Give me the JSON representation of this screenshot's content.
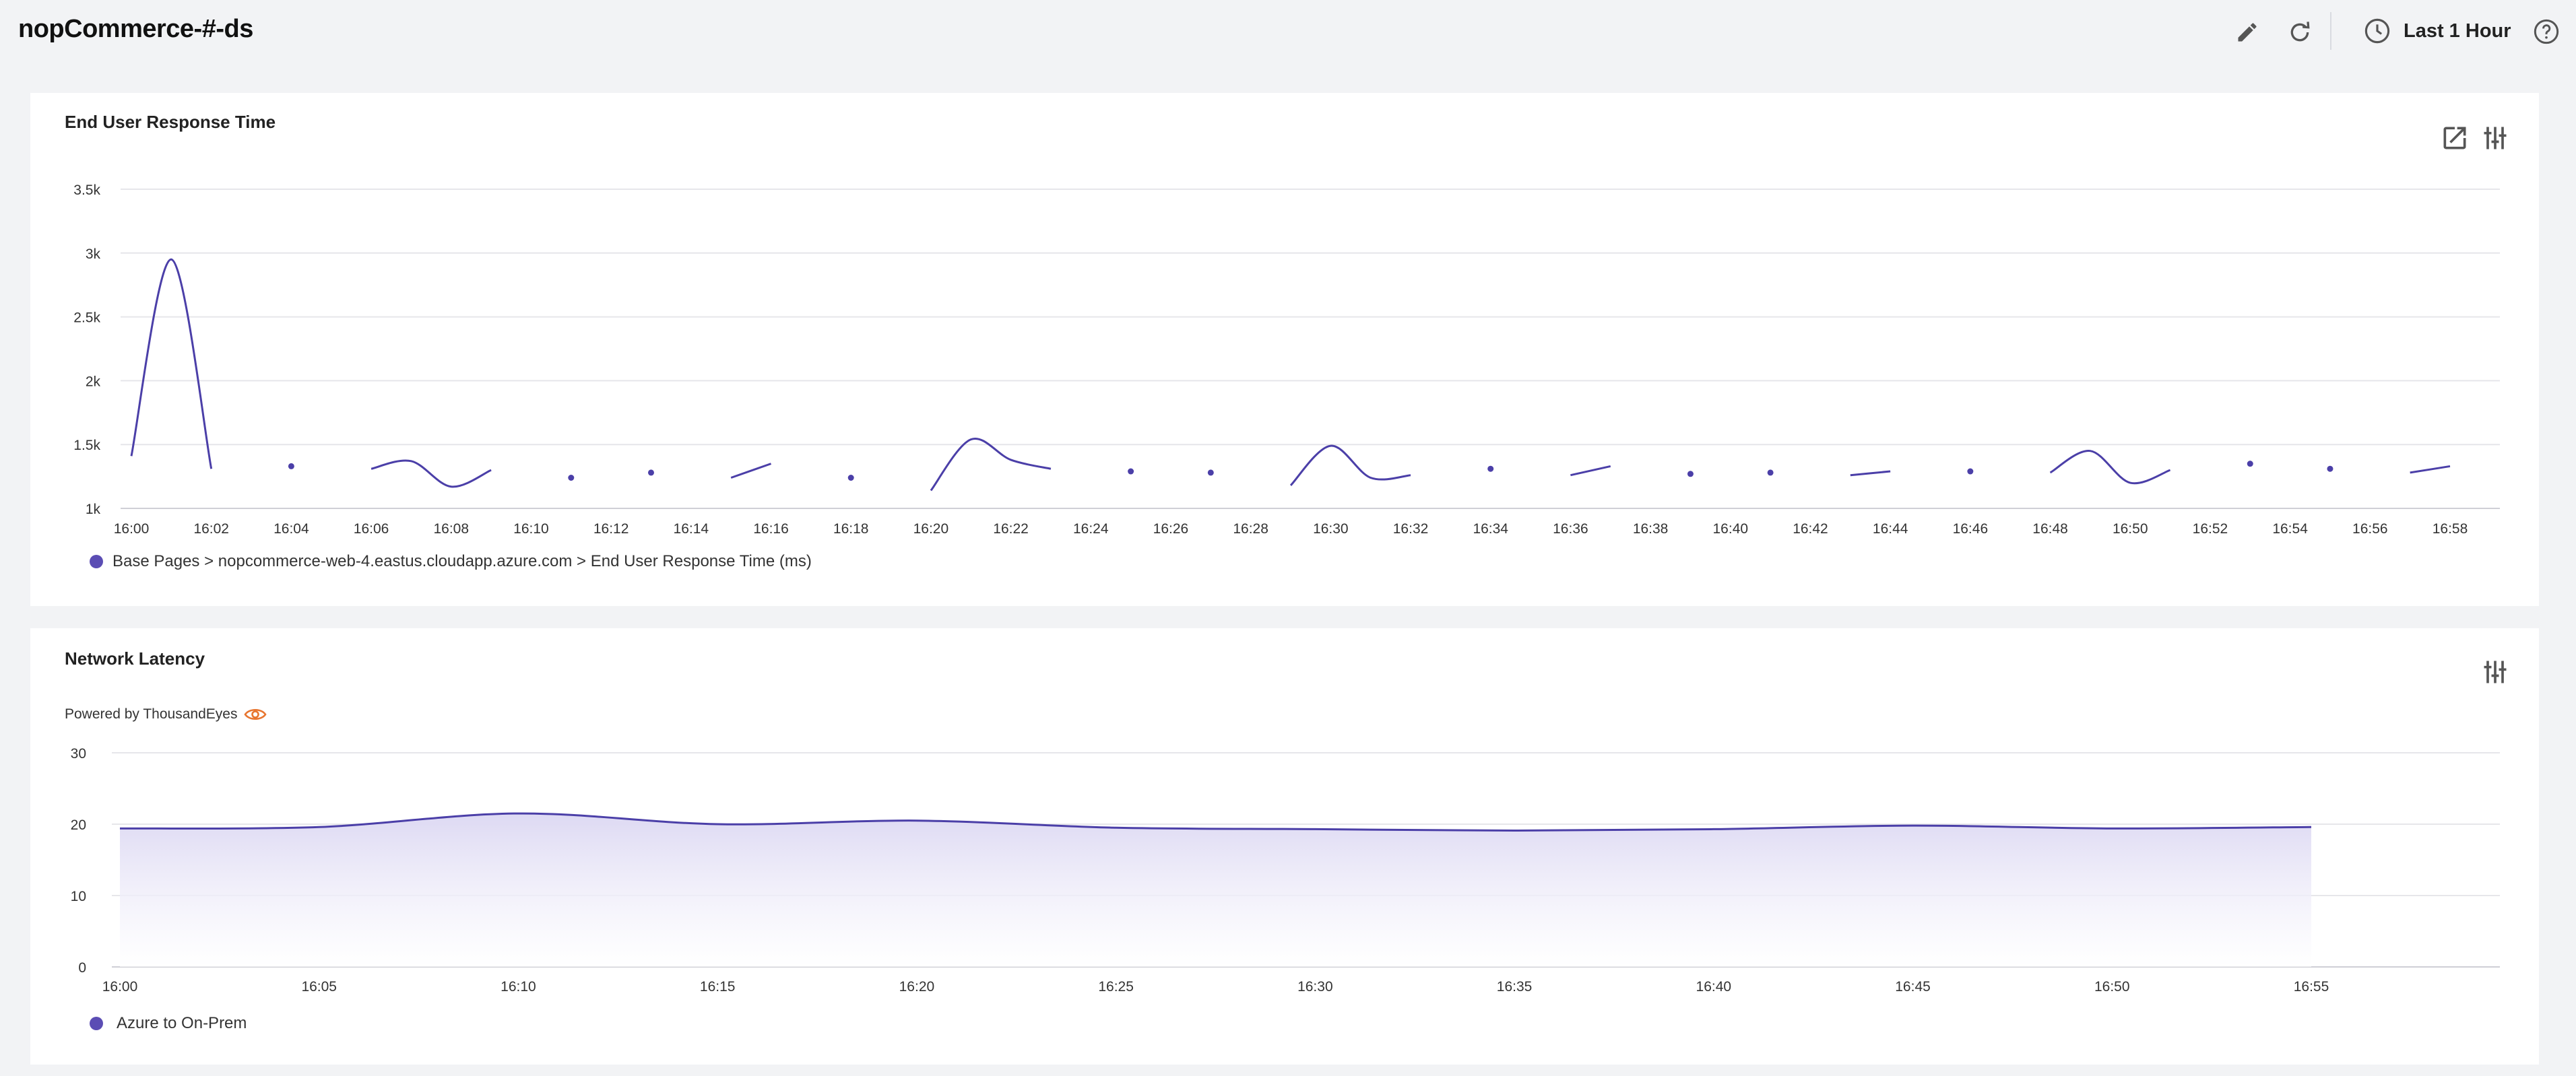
{
  "header": {
    "title": "nopCommerce-#-ds",
    "time_range": "Last 1 Hour",
    "icons": {
      "edit": "pencil-icon",
      "refresh": "refresh-icon",
      "clock": "clock-icon",
      "help": "help-icon"
    }
  },
  "colors": {
    "series": "#4b3fa8",
    "area_fill": "#ddd9f3",
    "grid": "#e6e6ea",
    "background": "#f2f3f5",
    "panel": "#ffffff",
    "eye_icon": "#e8752f"
  },
  "panels": {
    "response": {
      "title": "End User Response Time",
      "legend": "Base Pages > nopcommerce-web-4.eastus.cloudapp.azure.com > End User Response Time (ms)",
      "icons": [
        "external-link-icon",
        "settings-sliders-icon"
      ]
    },
    "latency": {
      "title": "Network Latency",
      "powered_by": "Powered by ThousandEyes",
      "legend": "Azure to On-Prem",
      "icons": [
        "eye-icon",
        "settings-sliders-icon"
      ]
    }
  },
  "chart_data": [
    {
      "type": "line",
      "title": "End User Response Time",
      "ylim": [
        1000,
        3500
      ],
      "y_ticks": [
        "1k",
        "1.5k",
        "2k",
        "2.5k",
        "3k",
        "3.5k"
      ],
      "y_tick_values": [
        1000,
        1500,
        2000,
        2500,
        3000,
        3500
      ],
      "x_range_minutes": [
        0,
        59
      ],
      "x_ticks": [
        "16:00",
        "16:02",
        "16:04",
        "16:06",
        "16:08",
        "16:10",
        "16:12",
        "16:14",
        "16:16",
        "16:18",
        "16:20",
        "16:22",
        "16:24",
        "16:26",
        "16:28",
        "16:30",
        "16:32",
        "16:34",
        "16:36",
        "16:38",
        "16:40",
        "16:42",
        "16:44",
        "16:46",
        "16:48",
        "16:50",
        "16:52",
        "16:54",
        "16:56",
        "16:58"
      ],
      "grid": true,
      "series": [
        {
          "name": "Base Pages > nopcommerce-web-4.eastus.cloudapp.azure.com > End User Response Time (ms)",
          "segments": [
            [
              [
                0,
                1410
              ],
              [
                1,
                2950
              ],
              [
                2,
                1310
              ]
            ],
            [
              [
                4,
                1330
              ]
            ],
            [
              [
                6,
                1310
              ],
              [
                7,
                1370
              ],
              [
                8,
                1170
              ],
              [
                9,
                1300
              ]
            ],
            [
              [
                11,
                1240
              ]
            ],
            [
              [
                13,
                1280
              ]
            ],
            [
              [
                15,
                1240
              ],
              [
                16,
                1350
              ]
            ],
            [
              [
                18,
                1240
              ]
            ],
            [
              [
                20,
                1140
              ],
              [
                21,
                1540
              ],
              [
                22,
                1380
              ],
              [
                23,
                1310
              ]
            ],
            [
              [
                25,
                1290
              ]
            ],
            [
              [
                27,
                1280
              ]
            ],
            [
              [
                29,
                1180
              ],
              [
                30,
                1490
              ],
              [
                31,
                1240
              ],
              [
                32,
                1260
              ]
            ],
            [
              [
                34,
                1310
              ]
            ],
            [
              [
                36,
                1260
              ],
              [
                37,
                1330
              ]
            ],
            [
              [
                39,
                1270
              ]
            ],
            [
              [
                41,
                1280
              ]
            ],
            [
              [
                43,
                1260
              ],
              [
                44,
                1290
              ]
            ],
            [
              [
                46,
                1290
              ]
            ],
            [
              [
                48,
                1280
              ],
              [
                49,
                1450
              ],
              [
                50,
                1200
              ],
              [
                51,
                1300
              ]
            ],
            [
              [
                53,
                1350
              ]
            ],
            [
              [
                55,
                1310
              ]
            ],
            [
              [
                57,
                1280
              ],
              [
                58,
                1330
              ]
            ]
          ]
        }
      ]
    },
    {
      "type": "area",
      "title": "Network Latency",
      "ylim": [
        0,
        30
      ],
      "y_ticks": [
        "0",
        "10",
        "20",
        "30"
      ],
      "y_tick_values": [
        0,
        10,
        20,
        30
      ],
      "x_range_minutes": [
        0,
        60
      ],
      "x_ticks": [
        "16:00",
        "16:05",
        "16:10",
        "16:15",
        "16:20",
        "16:25",
        "16:30",
        "16:35",
        "16:40",
        "16:45",
        "16:50",
        "16:55"
      ],
      "grid": true,
      "series": [
        {
          "name": "Azure to On-Prem",
          "x": [
            0,
            5,
            10,
            15,
            20,
            25,
            30,
            35,
            40,
            45,
            50,
            55
          ],
          "values": [
            19.4,
            19.6,
            21.5,
            20.0,
            20.5,
            19.5,
            19.3,
            19.1,
            19.3,
            19.8,
            19.4,
            19.6
          ]
        }
      ]
    }
  ]
}
